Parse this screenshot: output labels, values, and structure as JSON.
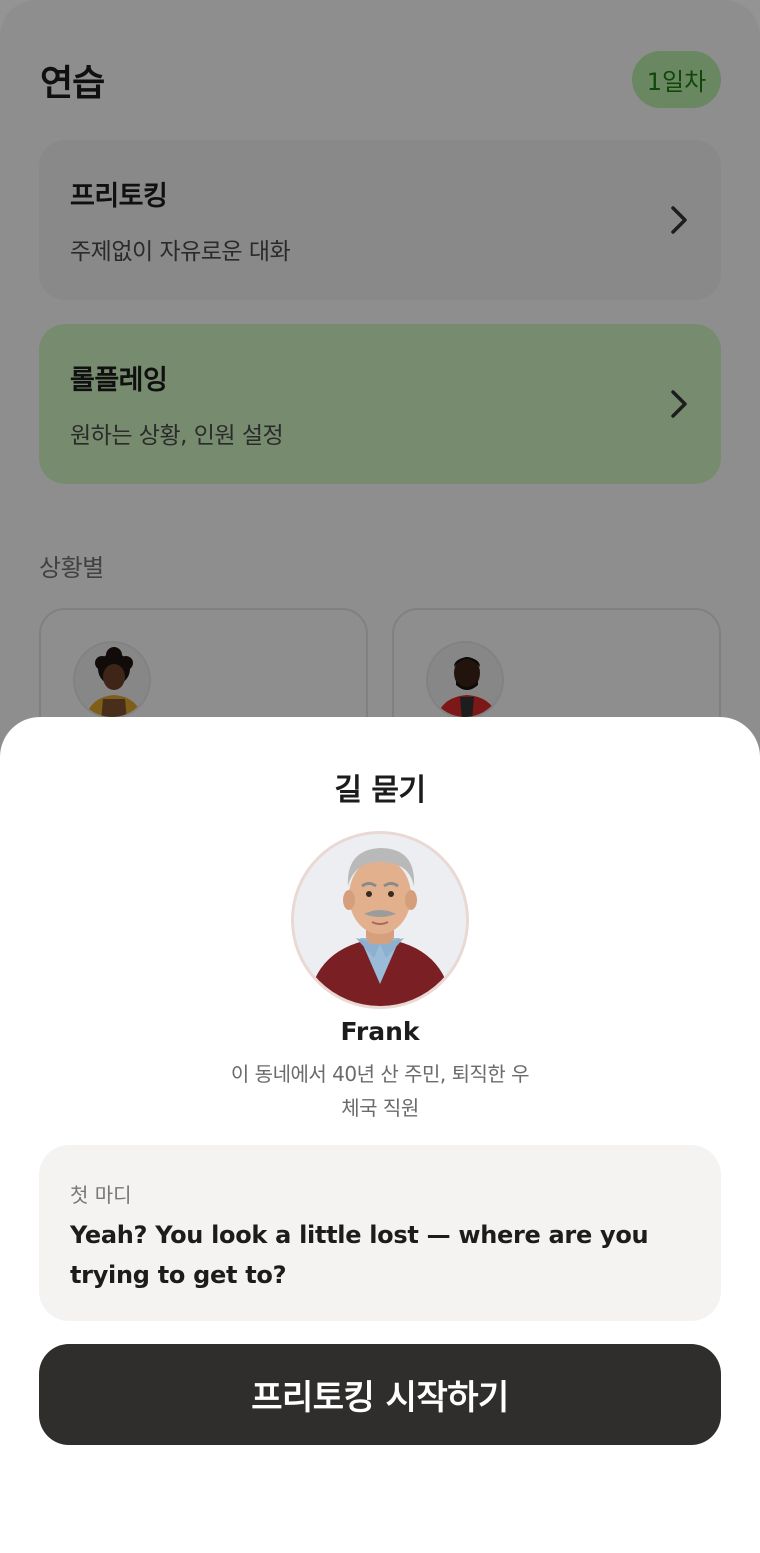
{
  "header": {
    "title": "연습",
    "day_badge": "1일차"
  },
  "modes": [
    {
      "title": "프리토킹",
      "subtitle": "주제없이 자유로운 대화"
    },
    {
      "title": "롤플레잉",
      "subtitle": "원하는 상황, 인원 설정"
    }
  ],
  "section_label": "상황별",
  "sheet": {
    "title": "길 묻기",
    "character": {
      "name": "Frank",
      "description": "이 동네에서 40년 산 주민, 퇴직한 우체국 직원"
    },
    "opening": {
      "label": "첫 마디",
      "text": "Yeah? You look a little lost — where are you trying to get to?"
    },
    "start_button": "프리토킹 시작하기"
  },
  "colors": {
    "accent_green": "#cdf0bf",
    "badge_text": "#1f7a14",
    "button_dark": "#2f2e2c"
  }
}
